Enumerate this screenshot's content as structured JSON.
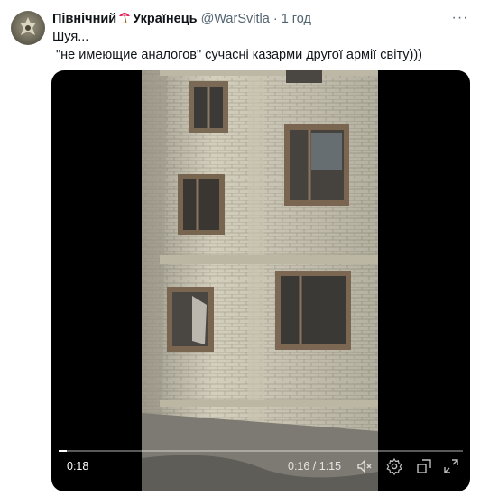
{
  "tweet": {
    "author_name_part1": "Північний",
    "author_name_part2": "Українець",
    "author_emoji_icon": "beach-umbrella-icon",
    "handle": "@WarSvitla",
    "separator": "·",
    "time": "1 год",
    "more_label": "···",
    "text": "Шуя...\n \"не имеющие аналогов\" сучасні казарми другої армії світу)))"
  },
  "video": {
    "elapsed": "0:18",
    "duration": "0:16 / 1:15",
    "progress_fraction": 0.02,
    "icons": [
      "mute-icon",
      "settings-icon",
      "popout-icon",
      "fullscreen-icon"
    ]
  },
  "colors": {
    "text": "#0f1419",
    "secondary": "#536471",
    "video_bg": "#000000"
  }
}
